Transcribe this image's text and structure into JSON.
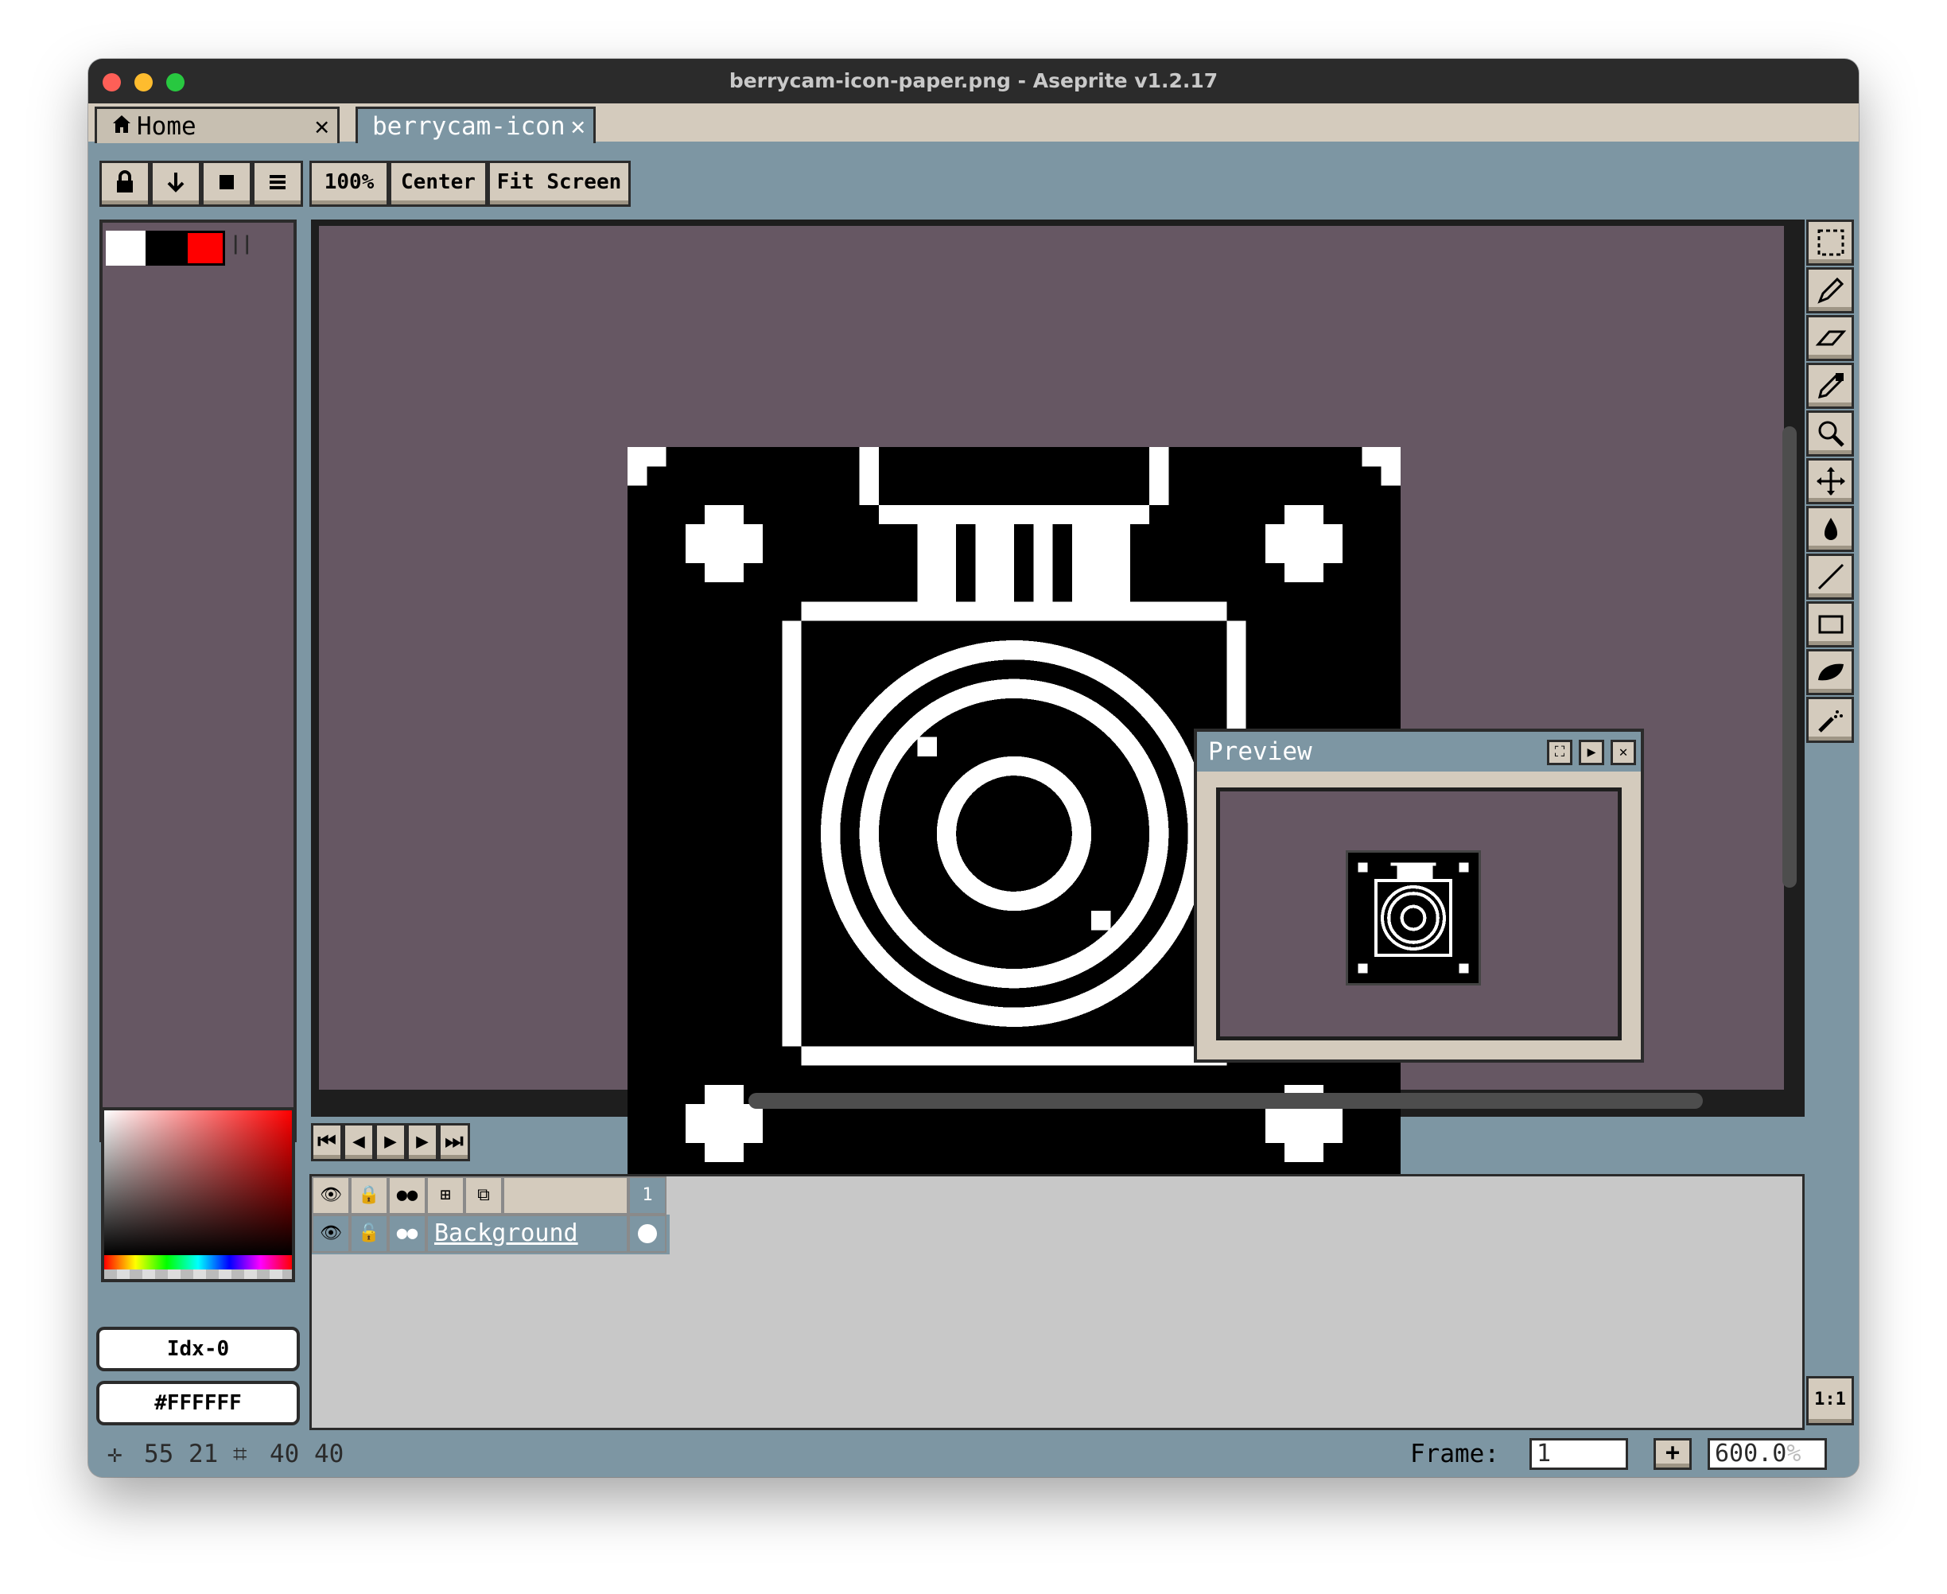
{
  "window": {
    "title": "berrycam-icon-paper.png - Aseprite v1.2.17"
  },
  "tabs": [
    {
      "label": "Home",
      "close": "✕"
    },
    {
      "label": "berrycam-icon",
      "close": "✕"
    }
  ],
  "toolbar": {
    "zoom_label": "100%",
    "center_label": "Center",
    "fit_label": "Fit Screen"
  },
  "icons": {
    "lock": "lock-icon",
    "down": "down-arrow-icon",
    "square": "square-icon",
    "menu": "menu-icon"
  },
  "palette": {
    "bg_color": "#665763",
    "fg_swatch": "#ffffff",
    "red_swatch": "#ff0000",
    "marker": "||"
  },
  "color_fields": {
    "index": "Idx-0",
    "hex": "#FFFFFF"
  },
  "preview": {
    "title": "Preview"
  },
  "timeline": {
    "frame_header": "1",
    "layers": [
      {
        "name": "Background"
      }
    ]
  },
  "status": {
    "position": "55 21",
    "size": "40 40",
    "frame_label": "Frame:",
    "frame_value": "1",
    "zoom_value": "600.0",
    "zoom_unit": "%",
    "plus_label": "+",
    "ratio_label": "1:1"
  },
  "accent_colors": {
    "chrome": "#7d96a3",
    "canvas_bg": "#665763",
    "tan": "#d4cbbd"
  }
}
